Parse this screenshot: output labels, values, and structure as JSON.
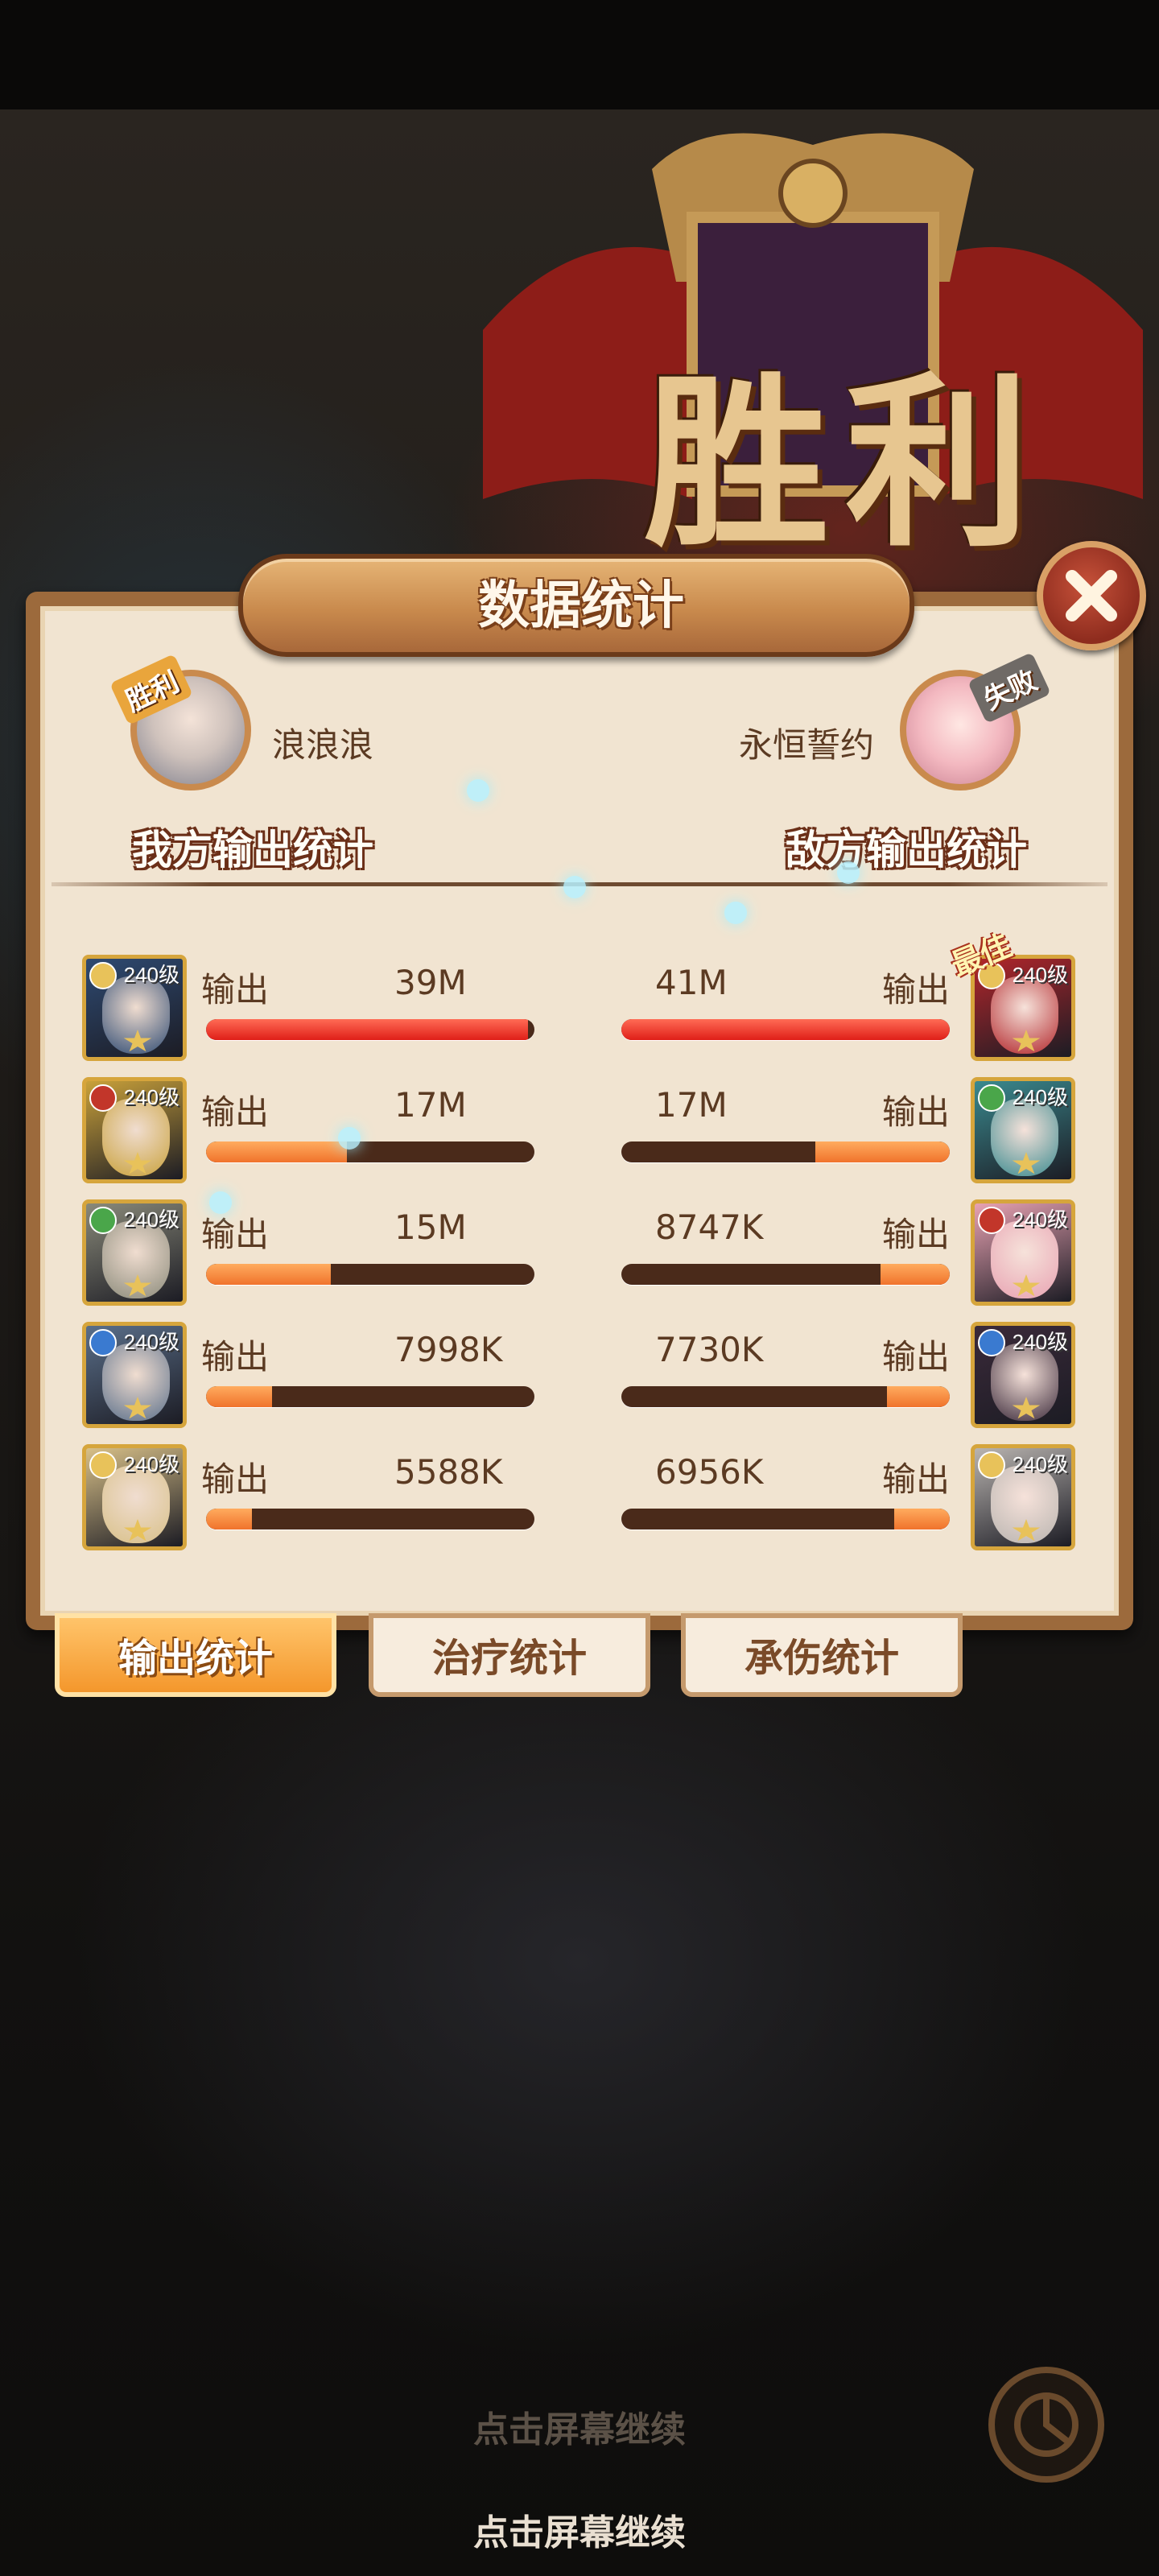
{
  "victory_title": "胜利",
  "panel": {
    "title": "数据统计",
    "close_icon": "close-icon"
  },
  "ally": {
    "tag": "胜利",
    "name": "浪浪浪",
    "label": "我方输出统计"
  },
  "enemy": {
    "tag": "失败",
    "name": "永恒誓约",
    "label": "敌方输出统计"
  },
  "stat_label": "输出",
  "level_label": "240级",
  "best_label": "最佳",
  "rows": [
    {
      "ally_value": "39M",
      "ally_fill": 0.98,
      "enemy_value": "41M",
      "enemy_fill": 1.0
    },
    {
      "ally_value": "17M",
      "ally_fill": 0.43,
      "enemy_value": "17M",
      "enemy_fill": 0.41
    },
    {
      "ally_value": "15M",
      "ally_fill": 0.38,
      "enemy_value": "8747K",
      "enemy_fill": 0.21
    },
    {
      "ally_value": "7998K",
      "ally_fill": 0.2,
      "enemy_value": "7730K",
      "enemy_fill": 0.19
    },
    {
      "ally_value": "5588K",
      "ally_fill": 0.14,
      "enemy_value": "6956K",
      "enemy_fill": 0.17
    }
  ],
  "tabs": [
    {
      "label": "输出统计",
      "active": true
    },
    {
      "label": "治疗统计",
      "active": false
    },
    {
      "label": "承伤统计",
      "active": false
    }
  ],
  "continue_hint": "点击屏幕继续",
  "colors": {
    "bar_fill": "#f0732c",
    "bar_top": "#df1f18",
    "bar_track": "#4a2a1a",
    "panel_bg": "#f1e4d1",
    "frame": "#9c6a3c"
  }
}
